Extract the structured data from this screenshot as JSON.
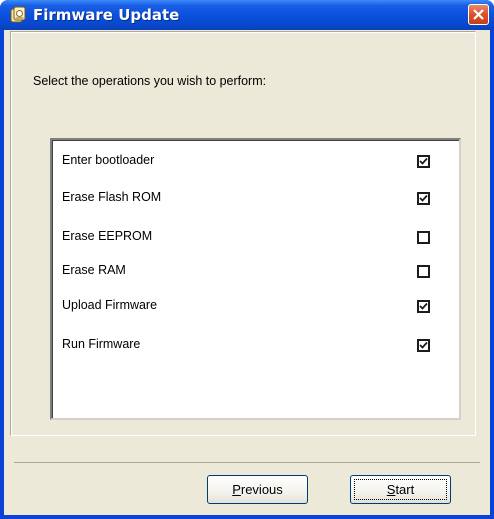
{
  "window": {
    "title": "Firmware Update"
  },
  "prompt": "Select the operations you wish to perform:",
  "operations": [
    {
      "label": "Enter bootloader",
      "checked": true
    },
    {
      "label": "Erase Flash ROM",
      "checked": true
    },
    {
      "label": "Erase EEPROM",
      "checked": false
    },
    {
      "label": "Erase RAM",
      "checked": false
    },
    {
      "label": "Upload Firmware",
      "checked": true
    },
    {
      "label": "Run Firmware",
      "checked": true
    }
  ],
  "buttons": {
    "previous": {
      "mnemonic": "P",
      "rest": "revious"
    },
    "start": {
      "mnemonic": "S",
      "rest": "tart"
    }
  },
  "icons": {
    "title": "firmware-app-icon",
    "close": "close-icon",
    "check": "checkmark-icon"
  },
  "colors": {
    "titlebar": "#0a4fdc",
    "client": "#ece9d8",
    "close": "#d8512b"
  }
}
